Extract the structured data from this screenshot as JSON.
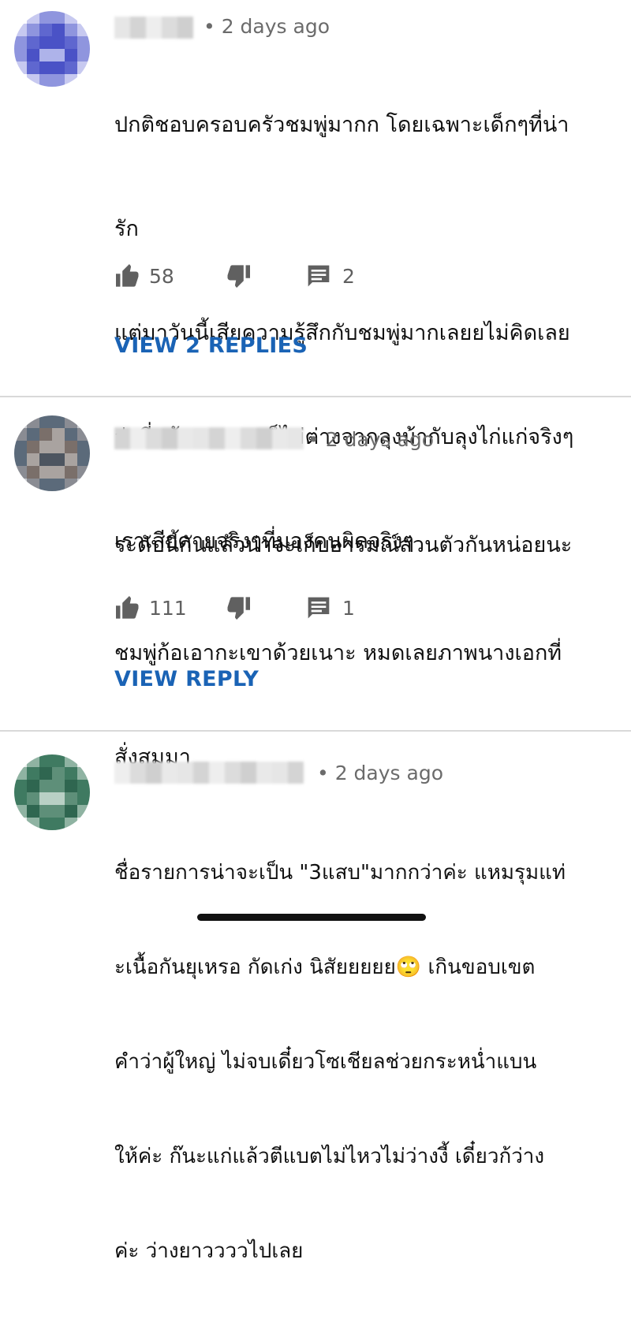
{
  "comments": [
    {
      "time": "• 2 days ago",
      "lines": [
        "ปกติชอบครอบครัวชมพู่มากก โดยเฉพาะเด็กๆที่น่า",
        "รัก",
        "แต่มาวันนี้เสียความรู้สึกกับชมพู่มากเลยยไม่คิดเลย",
        "ว่าที่แท้สมองนางก็ไม่ต่างจากลุงม้ากับลุงไก่แก่จริงๆ",
        "เราเสียดายจริงๆที่มองคนผิดจริงๆ"
      ],
      "likes": "58",
      "replies_count": "2",
      "reply_link": "VIEW 2 REPLIES",
      "avatar_colors": [
        "#ffffff",
        "#c7c9f0",
        "#8f95de",
        "#5f67cf",
        "#4a52c6",
        "#aeb3ea"
      ]
    },
    {
      "time": "• 2 days ago",
      "lines": [
        "ระดับนี้กันแล้วน่าจะเก็บอารมณ์ส่วนตัวกันหน่อยนะ",
        "ชมพู่ก้อเอากะเขาด้วยเนาะ หมดเลยภาพนางเอกที่",
        "สั่งสมมา"
      ],
      "likes": "111",
      "replies_count": "1",
      "reply_link": "VIEW REPLY",
      "avatar_colors": [
        "#c9cbd0",
        "#8a8c93",
        "#5b6a7a",
        "#7a6f6a",
        "#a9a3a0",
        "#4d5560"
      ]
    },
    {
      "time": "• 2 days ago",
      "lines": [
        "ชื่อรายการน่าจะเป็น \"3แสบ\"มากกว่าค่ะ แหมรุมแท่",
        "ะเนื้อกันยุเหรอ กัดเก่ง นิสัยยยยย🙄 เกินขอบเขต",
        "คำว่าผู้ใหญ่ ไม่จบเดี๋ยวโซเชียลช่วยกระหน่ำแบน",
        "ให้ค่ะ ก๊นะแก่แล้วตีแบตไม่ไหวไม่ว่างงี้ เดี๋ยวก้ว่าง",
        "ค่ะ ว่างยาววววไปเลย"
      ],
      "avatar_colors": [
        "#e8eeeb",
        "#8fb3a2",
        "#3f7a61",
        "#2f6650",
        "#5e8f79",
        "#b9d0c5"
      ]
    }
  ],
  "icons": {
    "like": "thumbs-up-icon",
    "dislike": "thumbs-down-icon",
    "reply": "comment-icon"
  },
  "colors": {
    "link": "#1a63b5",
    "meta": "#6b6b6b",
    "divider": "#d9d9d9"
  }
}
